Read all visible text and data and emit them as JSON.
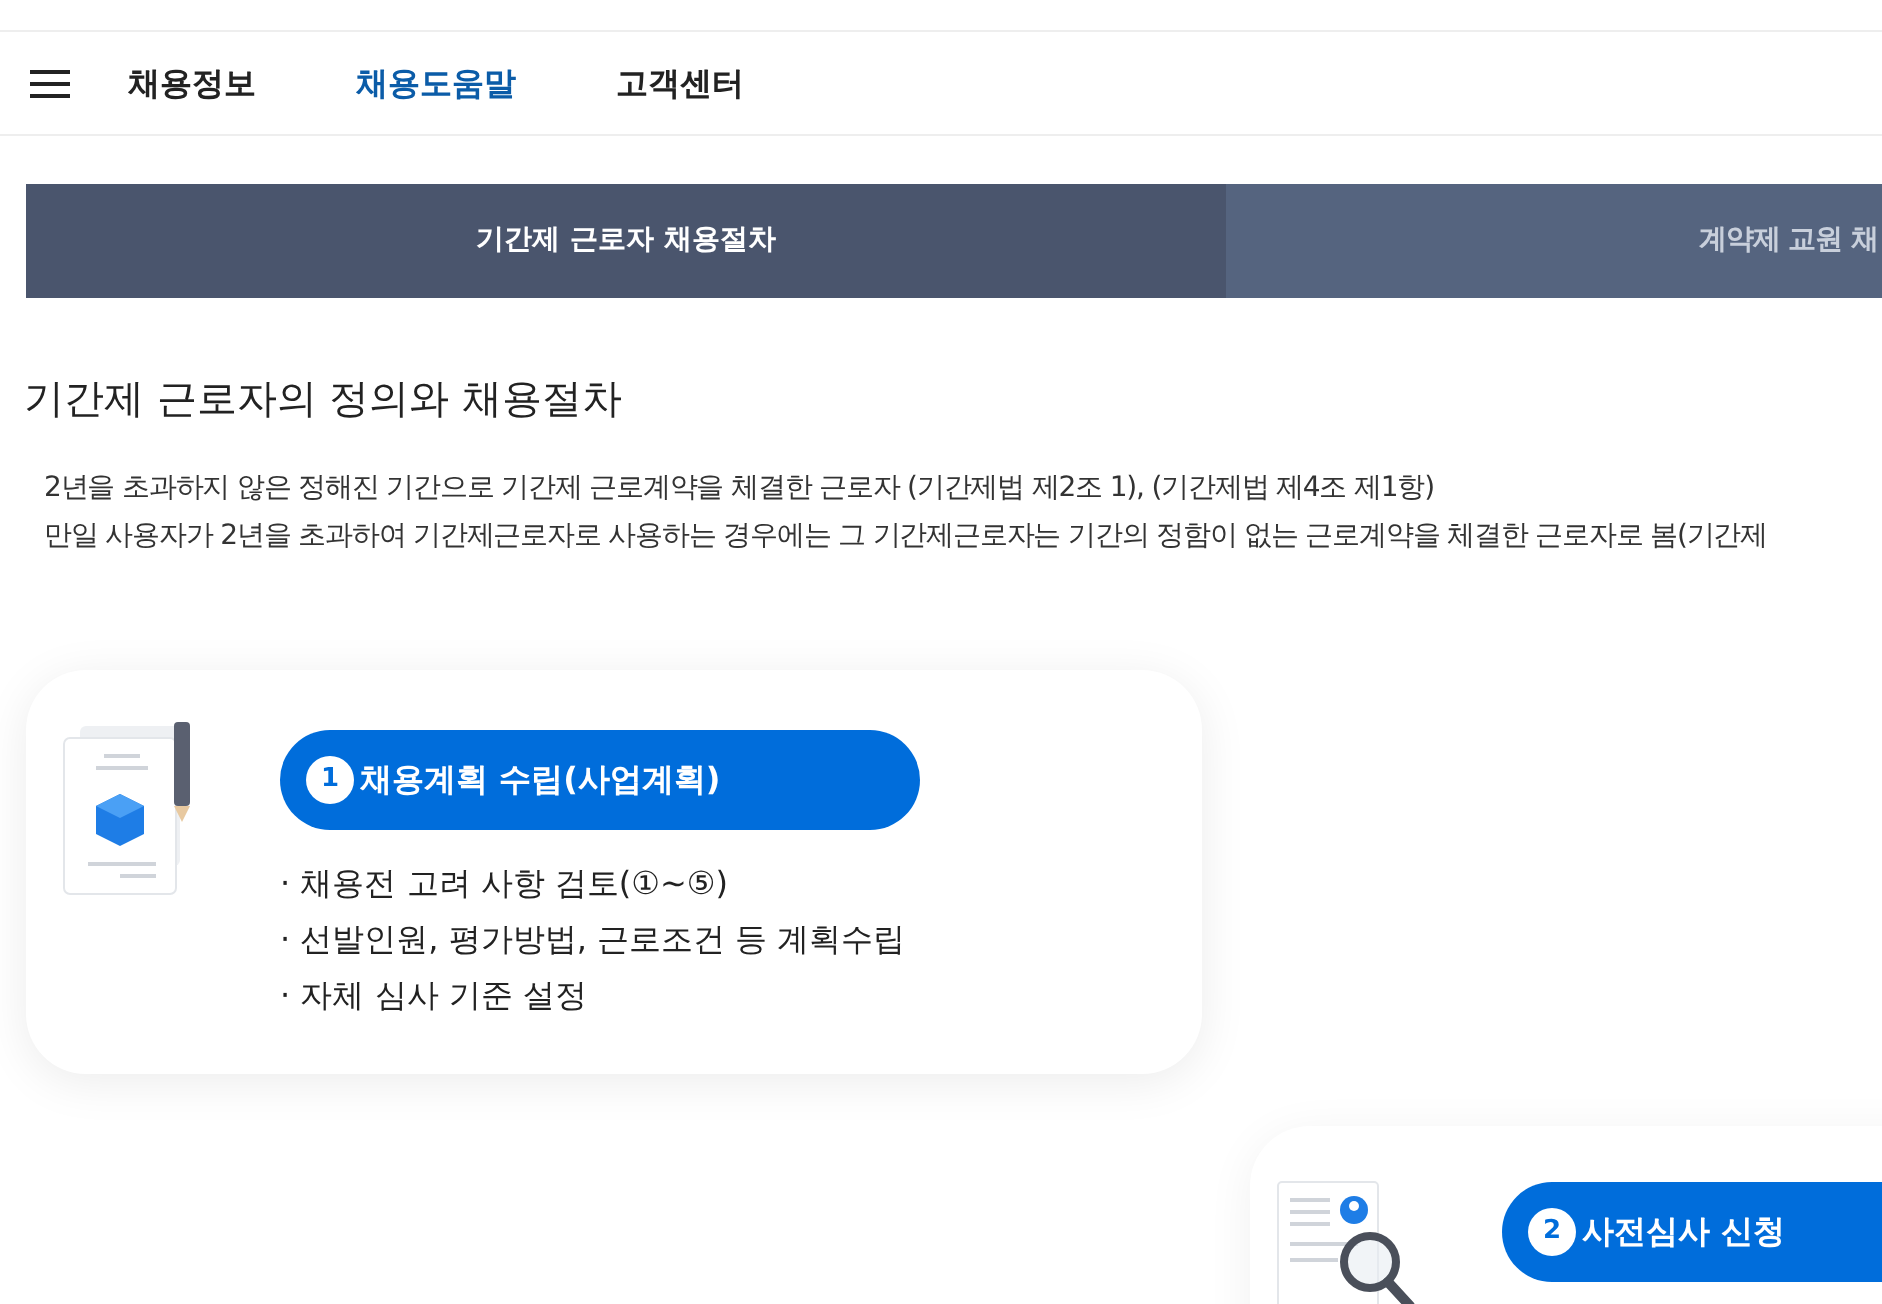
{
  "nav": {
    "items": [
      {
        "label": "채용정보",
        "selected": false
      },
      {
        "label": "채용도움말",
        "selected": true
      },
      {
        "label": "고객센터",
        "selected": false
      }
    ]
  },
  "tabs": [
    {
      "label": "기간제 근로자 채용절차",
      "selected": true
    },
    {
      "label": "계약제 교원 채",
      "selected": false
    }
  ],
  "heading": "기간제 근로자의 정의와 채용절차",
  "paragraphs": [
    "2년을 초과하지 않은 정해진 기간으로 기간제 근로계약을 체결한 근로자 (기간제법 제2조 1), (기간제법 제4조 제1항)",
    "만일 사용자가 2년을 초과하여 기간제근로자로 사용하는 경우에는 그 기간제근로자는 기간의 정함이 없는 근로계약을 체결한 근로자로 봄(기간제"
  ],
  "steps": [
    {
      "number": "1",
      "title": "채용계획 수립(사업계획)",
      "bullets": [
        "· 채용전 고려 사항 검토(①~⑤)",
        "· 선발인원, 평가방법, 근로조건 등 계획수립",
        "· 자체 심사 기준 설정"
      ]
    },
    {
      "number": "2",
      "title": "사전심사 신청"
    }
  ]
}
